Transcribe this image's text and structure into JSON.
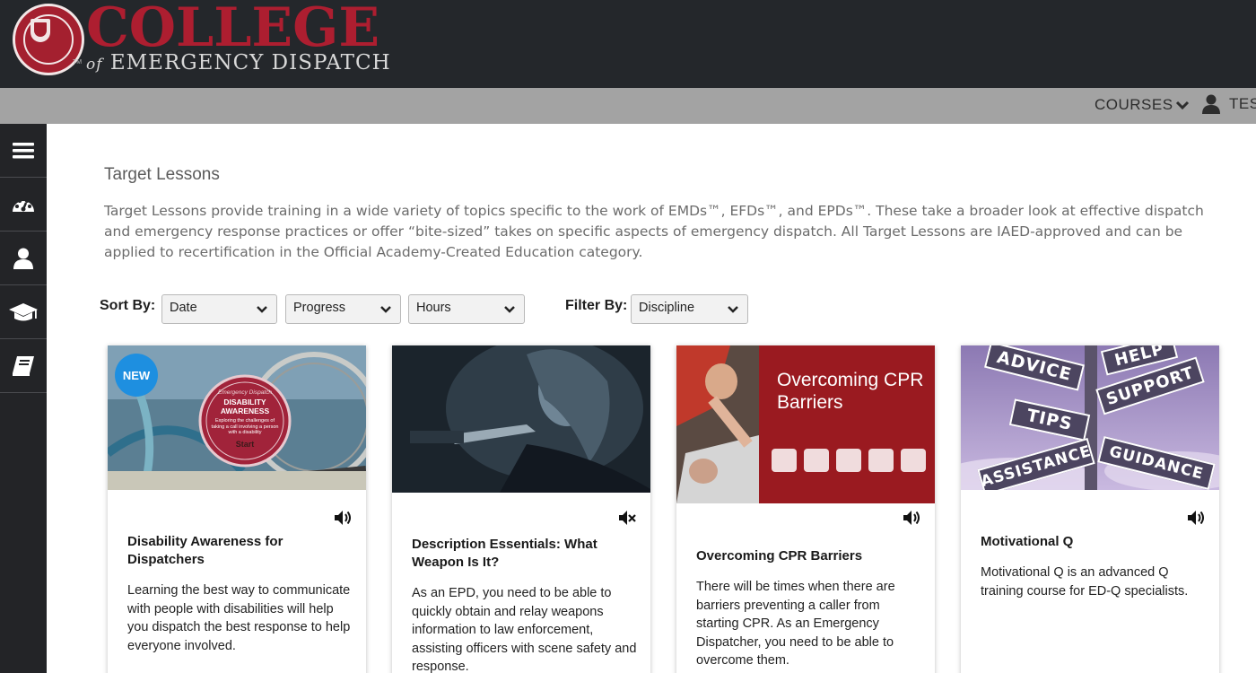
{
  "brand": {
    "name_line1": "COLLEGE",
    "name_of": "of",
    "name_line2": "EMERGENCY DISPATCH",
    "tm": "TM",
    "colors": {
      "header_bg": "#24272b",
      "brand_red": "#ad1e30",
      "nav_bg": "#a3a3a3",
      "sidebar_bg": "#232427"
    }
  },
  "topnav": {
    "courses_label": "COURSES",
    "courses_icon": "chevron-down-icon",
    "user_icon": "user-icon",
    "user_label": "TES"
  },
  "sidebar": {
    "items": [
      {
        "icon": "menu-icon"
      },
      {
        "icon": "dashboard-icon"
      },
      {
        "icon": "user-icon"
      },
      {
        "icon": "graduation-cap-icon"
      },
      {
        "icon": "book-icon"
      }
    ]
  },
  "main": {
    "title": "Target Lessons",
    "intro": "Target Lessons provide training in a wide variety of topics specific to the work of EMDs™, EFDs™, and EPDs™. These take a broader look at effective dispatch and emergency response practices or offer “bite-sized” takes on specific aspects of emergency dispatch. All Target Lessons are IAED-approved and can be applied to recertification in the Official Academy-Created Education category."
  },
  "controls": {
    "sort_label": "Sort By:",
    "filter_label": "Filter By:",
    "sort_date": "Date",
    "sort_progress": "Progress",
    "sort_hours": "Hours",
    "filter_discipline": "Discipline"
  },
  "cards": [
    {
      "badge": "NEW",
      "audio_icon": "volume-icon",
      "title": "Disability Awareness for Dispatchers",
      "description": "Learning the best way to communicate with people with disabilities will help you dispatch the best response to help everyone involved.",
      "image": {
        "seal_top": "Emergency Dispatch",
        "seal_title": "DISABILITY AWARENESS",
        "seal_sub": "Exploring the challenges of taking a call involving a person with a disability",
        "seal_start": "Start"
      }
    },
    {
      "audio_icon": "volume-mute-icon",
      "title": "Description Essentials: What Weapon Is It?",
      "description": "As an EPD, you need to be able to quickly obtain and relay weapons information to law enforcement, assisting officers with scene safety and response."
    },
    {
      "audio_icon": "volume-icon",
      "title": "Overcoming CPR Barriers",
      "description": "There will be times when there are barriers preventing a caller from starting CPR. As an Emergency Dispatcher, you need to be able to overcome them.",
      "image": {
        "title": "Overcoming CPR Barriers"
      }
    },
    {
      "audio_icon": "volume-icon",
      "title": "Motivational Q",
      "description": "Motivational Q is an advanced Q training course for ED-Q specialists.",
      "image": {
        "signs": [
          "ADVICE",
          "HELP",
          "SUPPORT",
          "TIPS",
          "ASSISTANCE",
          "GUIDANCE"
        ]
      }
    }
  ]
}
